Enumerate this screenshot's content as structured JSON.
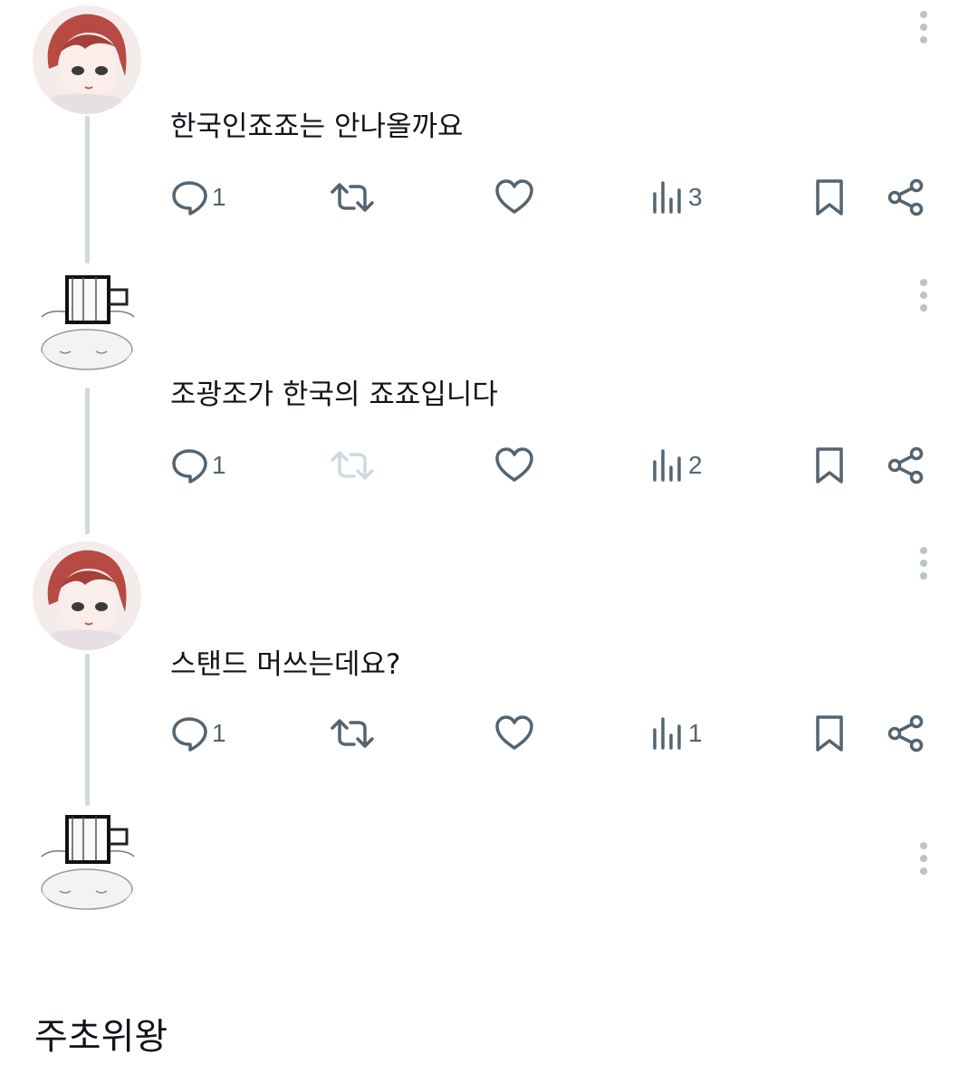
{
  "replies": [
    {
      "text": "한국인죠죠는 안나올까요",
      "reply_count": "1",
      "repost_count": "",
      "like_count": "",
      "view_count": "3",
      "repost_disabled": false,
      "avatar": "red-hair-anime-avatar"
    },
    {
      "text": "조광조가 한국의 죠죠입니다",
      "reply_count": "1",
      "repost_count": "",
      "like_count": "",
      "view_count": "2",
      "repost_disabled": true,
      "avatar": "sketch-cup-avatar"
    },
    {
      "text": "스탠드 머쓰는데요?",
      "reply_count": "1",
      "repost_count": "",
      "like_count": "",
      "view_count": "1",
      "repost_disabled": false,
      "avatar": "red-hair-anime-avatar"
    },
    {
      "text": "",
      "avatar": "sketch-cup-avatar"
    }
  ],
  "footer": {
    "name": "주초위왕"
  },
  "icons": {
    "reply": "reply-icon",
    "repost": "repost-icon",
    "like": "heart-icon",
    "views": "analytics-icon",
    "bookmark": "bookmark-icon",
    "share": "share-icon",
    "more": "more-vertical-icon"
  },
  "colors": {
    "icon": "#536471",
    "thread_line": "#cfd9de",
    "disabled_icon": "#cfd9de"
  }
}
